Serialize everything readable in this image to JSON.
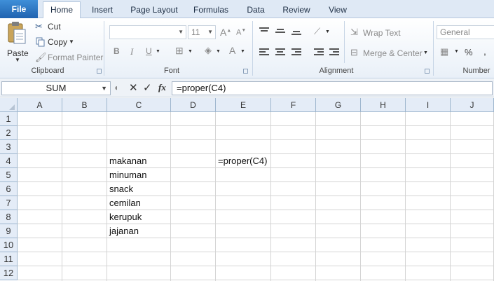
{
  "tabs": [
    "File",
    "Home",
    "Insert",
    "Page Layout",
    "Formulas",
    "Data",
    "Review",
    "View"
  ],
  "clipboard": {
    "paste": "Paste",
    "cut": "Cut",
    "copy": "Copy",
    "format_painter": "Format Painter",
    "label": "Clipboard"
  },
  "font": {
    "name": "",
    "size": "11",
    "bold": "B",
    "italic": "I",
    "underline": "U",
    "label": "Font"
  },
  "alignment": {
    "wrap_text": "Wrap Text",
    "merge_center": "Merge & Center",
    "label": "Alignment"
  },
  "number": {
    "format": "General",
    "percent": "%",
    "comma": ",",
    "label": "Number"
  },
  "formula_bar": {
    "name_box": "SUM",
    "fx": "fx",
    "formula": "=proper(C4)"
  },
  "columns": [
    "A",
    "B",
    "C",
    "D",
    "E",
    "F",
    "G",
    "H",
    "I",
    "J"
  ],
  "rows": [
    "1",
    "2",
    "3",
    "4",
    "5",
    "6",
    "7",
    "8",
    "9",
    "10",
    "11",
    "12"
  ],
  "cells": {
    "C4": "makanan",
    "C5": "minuman",
    "C6": "snack",
    "C7": "cemilan",
    "C8": "kerupuk",
    "C9": "jajanan",
    "E4": "=proper(C4)"
  },
  "colors": {
    "file_tab": "#2a72c3",
    "header_bg": "#e4ecf7",
    "gridline": "#d4d4d4"
  }
}
